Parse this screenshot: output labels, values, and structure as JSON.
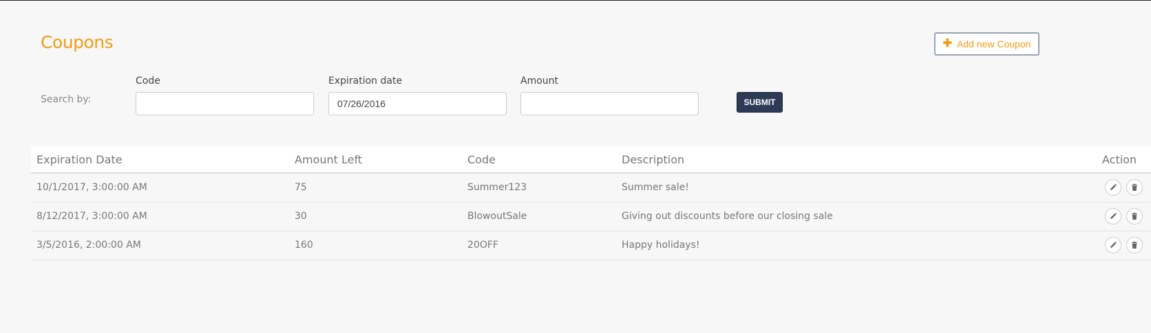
{
  "page": {
    "title": "Coupons",
    "add_button_label": "Add new Coupon",
    "add_button_icon": "plus-icon",
    "accent_color": "#f39c12"
  },
  "search": {
    "label": "Search by:",
    "fields": [
      {
        "label": "Code",
        "value": ""
      },
      {
        "label": "Expiration date",
        "value": "07/26/2016"
      },
      {
        "label": "Amount",
        "value": ""
      }
    ],
    "submit_label": "SUBMIT",
    "submit_color": "#2c3a55"
  },
  "table": {
    "headers": [
      "Expiration Date",
      "Amount Left",
      "Code",
      "Description",
      "Action"
    ],
    "rows": [
      {
        "expiration": "10/1/2017, 3:00:00 AM",
        "amount": "75",
        "code": "Summer123",
        "description": "Summer sale!"
      },
      {
        "expiration": "8/12/2017, 3:00:00 AM",
        "amount": "30",
        "code": "BlowoutSale",
        "description": "Giving out discounts before our closing sale"
      },
      {
        "expiration": "3/5/2016, 2:00:00 AM",
        "amount": "160",
        "code": "20OFF",
        "description": "Happy holidays!"
      }
    ],
    "row_action_icons": [
      "pencil-icon",
      "trash-icon"
    ]
  }
}
